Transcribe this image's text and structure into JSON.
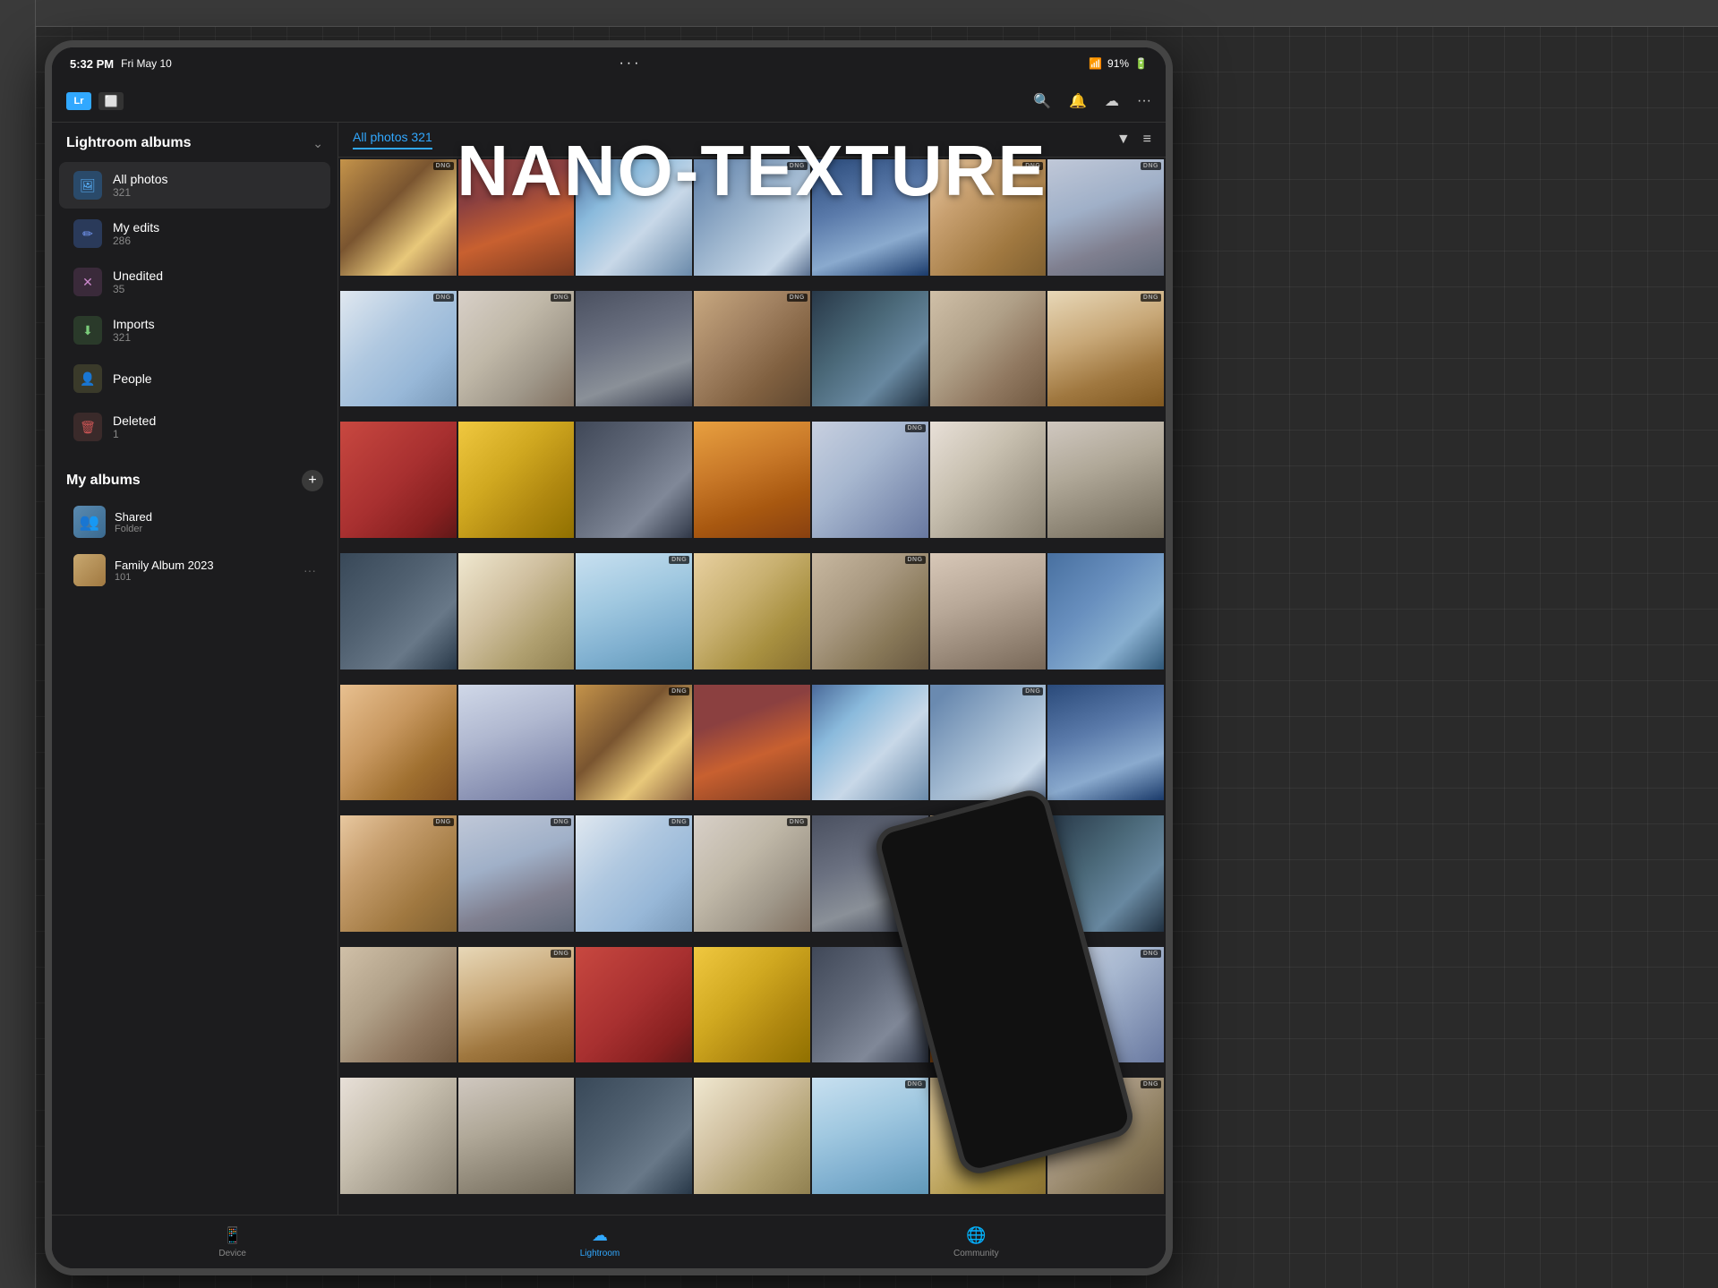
{
  "app": {
    "title": "NANO-TEXTURE",
    "status_bar": {
      "time": "5:32 PM",
      "date": "Fri May 10",
      "battery": "91%",
      "dots": "···"
    }
  },
  "sidebar": {
    "albums_header": "Lightroom albums",
    "items": [
      {
        "id": "all-photos",
        "label": "All photos",
        "count": "321",
        "icon": "photo"
      },
      {
        "id": "my-edits",
        "label": "My edits",
        "count": "286",
        "icon": "edit"
      },
      {
        "id": "unedited",
        "label": "Unedited",
        "count": "35",
        "icon": "unedited"
      },
      {
        "id": "imports",
        "label": "Imports",
        "count": "321",
        "icon": "import"
      },
      {
        "id": "people",
        "label": "People",
        "count": "",
        "icon": "people"
      },
      {
        "id": "deleted",
        "label": "Deleted",
        "count": "1",
        "icon": "deleted"
      }
    ],
    "my_albums_header": "My albums",
    "albums": [
      {
        "id": "shared",
        "name": "Shared",
        "subtitle": "Folder",
        "thumb": "shared"
      },
      {
        "id": "family",
        "name": "Family Album 2023",
        "count": "101",
        "thumb": "family"
      }
    ]
  },
  "tabs": {
    "active": "All photos",
    "active_count": "321"
  },
  "bottom_bar": {
    "tabs": [
      {
        "id": "device",
        "label": "Device",
        "icon": "📱"
      },
      {
        "id": "lightroom",
        "label": "Lightroom",
        "icon": "☁"
      },
      {
        "id": "community",
        "label": "Community",
        "icon": "🌐"
      }
    ]
  },
  "grid": {
    "photos": [
      {
        "id": 1,
        "class": "p1",
        "dng": true
      },
      {
        "id": 2,
        "class": "p2",
        "dng": false
      },
      {
        "id": 3,
        "class": "p3",
        "dng": false
      },
      {
        "id": 4,
        "class": "p4",
        "dng": true
      },
      {
        "id": 5,
        "class": "p5",
        "dng": false
      },
      {
        "id": 6,
        "class": "p6",
        "dng": true
      },
      {
        "id": 7,
        "class": "p7",
        "dng": true
      },
      {
        "id": 8,
        "class": "p8",
        "dng": true
      },
      {
        "id": 9,
        "class": "p9",
        "dng": true
      },
      {
        "id": 10,
        "class": "p10",
        "dng": false
      },
      {
        "id": 11,
        "class": "p11",
        "dng": true
      },
      {
        "id": 12,
        "class": "p12",
        "dng": false
      },
      {
        "id": 13,
        "class": "p13",
        "dng": false
      },
      {
        "id": 14,
        "class": "p14",
        "dng": true
      },
      {
        "id": 15,
        "class": "p15",
        "dng": false
      },
      {
        "id": 16,
        "class": "p16",
        "dng": false
      },
      {
        "id": 17,
        "class": "p17",
        "dng": false
      },
      {
        "id": 18,
        "class": "p18",
        "dng": false
      },
      {
        "id": 19,
        "class": "p19",
        "dng": true
      },
      {
        "id": 20,
        "class": "p20",
        "dng": false
      },
      {
        "id": 21,
        "class": "p21",
        "dng": false
      },
      {
        "id": 22,
        "class": "p22",
        "dng": false
      },
      {
        "id": 23,
        "class": "p23",
        "dng": false
      },
      {
        "id": 24,
        "class": "p24",
        "dng": true
      },
      {
        "id": 25,
        "class": "p25",
        "dng": false
      },
      {
        "id": 26,
        "class": "p26",
        "dng": true
      },
      {
        "id": 27,
        "class": "p27",
        "dng": false
      },
      {
        "id": 28,
        "class": "p28",
        "dng": false
      },
      {
        "id": 29,
        "class": "p29",
        "dng": false
      },
      {
        "id": 30,
        "class": "p30",
        "dng": false
      },
      {
        "id": 31,
        "class": "p1",
        "dng": true
      },
      {
        "id": 32,
        "class": "p5",
        "dng": false
      },
      {
        "id": 33,
        "class": "p3",
        "dng": false
      },
      {
        "id": 34,
        "class": "p8",
        "dng": true
      },
      {
        "id": 35,
        "class": "p2",
        "dng": false
      },
      {
        "id": 36,
        "class": "p11",
        "dng": false
      },
      {
        "id": 37,
        "class": "p14",
        "dng": false
      },
      {
        "id": 38,
        "class": "p7",
        "dng": false
      },
      {
        "id": 39,
        "class": "p20",
        "dng": false
      },
      {
        "id": 40,
        "class": "p25",
        "dng": false
      },
      {
        "id": 41,
        "class": "p4",
        "dng": false
      },
      {
        "id": 42,
        "class": "p9",
        "dng": false
      }
    ]
  }
}
